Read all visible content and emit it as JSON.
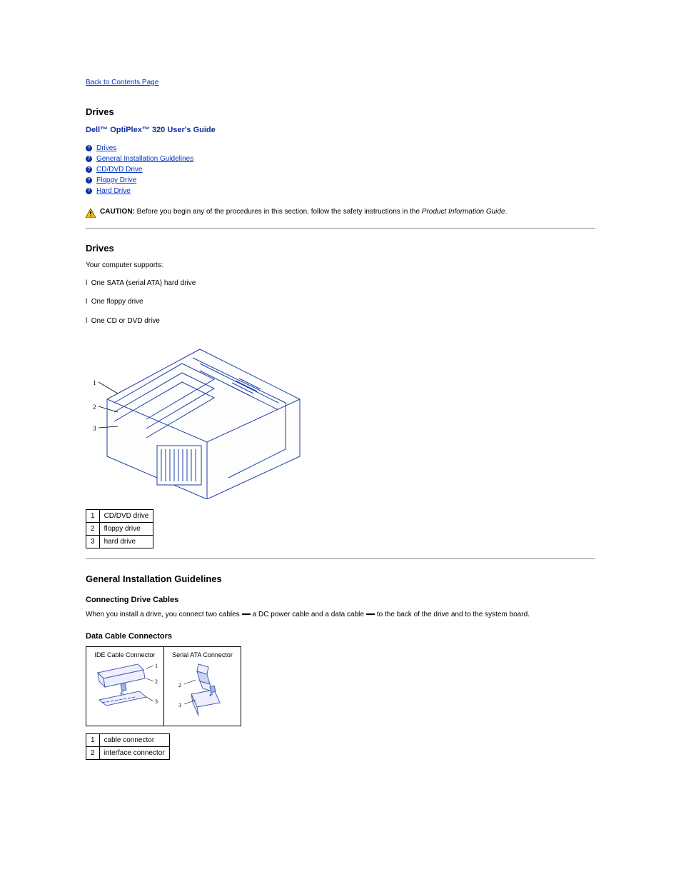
{
  "topnav": {
    "back": "Back to Contents Page"
  },
  "title": "Drives",
  "subtitle": "Dell™ OptiPlex™ 320 User's Guide",
  "links": {
    "items": [
      {
        "label": "Drives"
      },
      {
        "label": "General Installation Guidelines"
      },
      {
        "label": "CD/DVD Drive"
      },
      {
        "label": "Floppy Drive"
      },
      {
        "label": "Hard Drive"
      }
    ]
  },
  "section_drives": {
    "title": "Drives",
    "intro_text": "Your computer supports:",
    "bullets": [
      "One SATA (serial ATA) hard drive",
      "One floppy drive",
      "One CD or DVD drive"
    ],
    "legend": [
      {
        "num": "1",
        "label": "CD/DVD drive"
      },
      {
        "num": "2",
        "label": "floppy drive"
      },
      {
        "num": "3",
        "label": "hard drive"
      }
    ]
  },
  "section_guidelines": {
    "title": "General Installation Guidelines",
    "sub1": "Connecting Drive Cables",
    "text1": "When you install a drive, you connect two cables",
    "text1_after_bar1": "a DC power cable and a data cable",
    "text1_after_bar2": "to the back of the drive and to the system board.",
    "sub2": "Data Cable Connectors",
    "connectors": [
      {
        "header": "IDE Cable Connector"
      },
      {
        "header": "Serial ATA Connector"
      }
    ],
    "small_legend": [
      {
        "num": "1",
        "label": "cable connector"
      },
      {
        "num": "2",
        "label": "interface connector"
      }
    ]
  },
  "caution": {
    "label": "CAUTION:",
    "text": "Before you begin any of the procedures in this section, follow the safety instructions in the",
    "link": "Product Information Guide",
    "tail": "."
  }
}
